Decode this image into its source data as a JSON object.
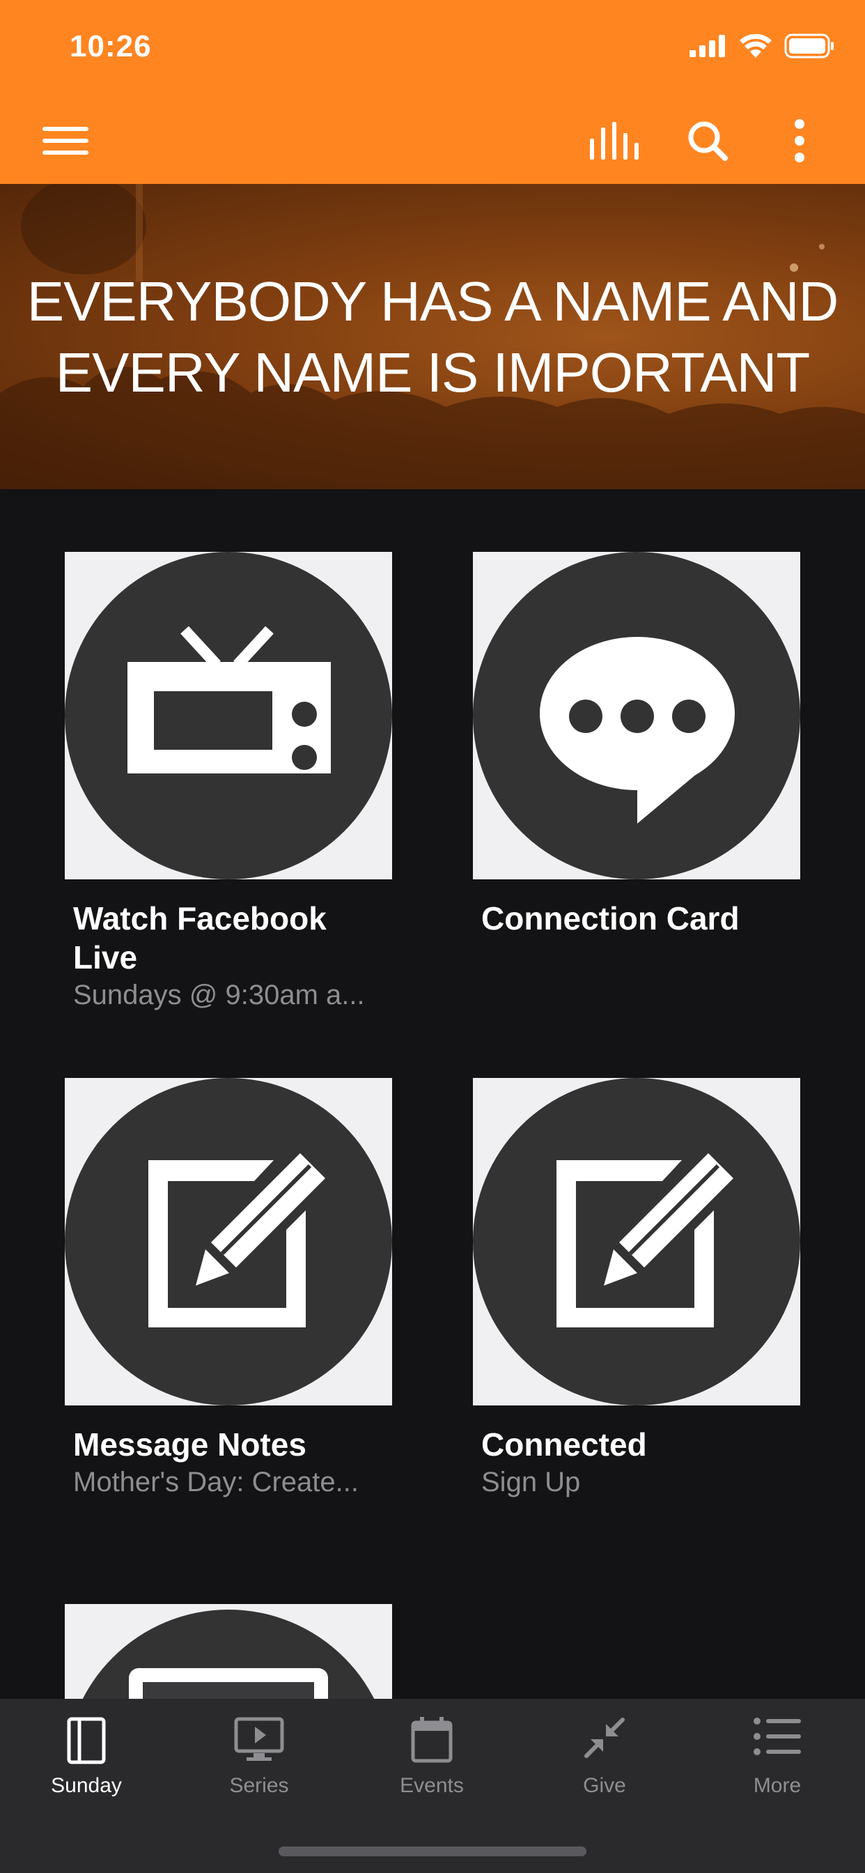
{
  "status_bar": {
    "time": "10:26"
  },
  "app_bar": {
    "menu_icon": "hamburger-menu-icon",
    "actions": [
      "audio-bars-icon",
      "search-icon",
      "more-vertical-icon"
    ]
  },
  "hero": {
    "line1": "EVERYBODY HAS A NAME AND",
    "line2": "EVERY NAME IS IMPORTANT"
  },
  "tiles": [
    {
      "icon": "tv-icon",
      "title": "Watch Facebook Live",
      "subtitle": "Sundays @ 9:30am a..."
    },
    {
      "icon": "speech-bubble-icon",
      "title": "Connection Card",
      "subtitle": ""
    },
    {
      "icon": "edit-note-icon",
      "title": "Message Notes",
      "subtitle": "Mother's Day: Create..."
    },
    {
      "icon": "edit-note-icon",
      "title": "Connected",
      "subtitle": "Sign Up"
    },
    {
      "icon": "device-icon",
      "title": "",
      "subtitle": ""
    }
  ],
  "tab_bar": {
    "tabs": [
      {
        "label": "Sunday",
        "icon": "book-icon",
        "active": true
      },
      {
        "label": "Series",
        "icon": "play-screen-icon",
        "active": false
      },
      {
        "label": "Events",
        "icon": "calendar-icon",
        "active": false
      },
      {
        "label": "Give",
        "icon": "collapse-arrows-icon",
        "active": false
      },
      {
        "label": "More",
        "icon": "list-icon",
        "active": false
      }
    ]
  },
  "colors": {
    "brand_orange": "#ff8521",
    "background": "#131315",
    "tile_circle": "#333334",
    "tab_bar": "#2a2a2c",
    "muted_text": "#8e8e92"
  }
}
